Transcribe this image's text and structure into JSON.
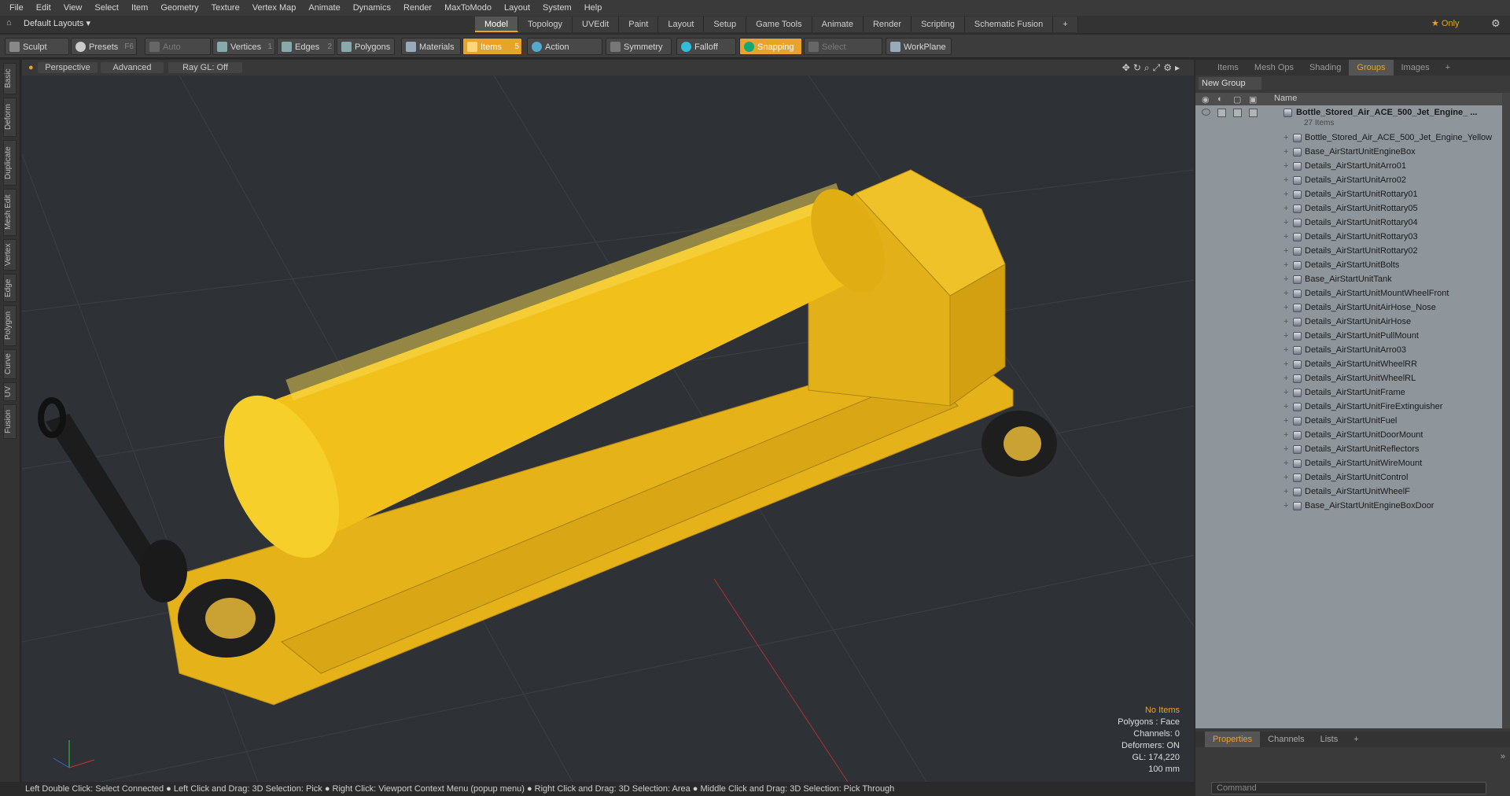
{
  "menu": [
    "File",
    "Edit",
    "View",
    "Select",
    "Item",
    "Geometry",
    "Texture",
    "Vertex Map",
    "Animate",
    "Dynamics",
    "Render",
    "MaxToModo",
    "Layout",
    "System",
    "Help"
  ],
  "layout_dropdown": "Default Layouts ▾",
  "layout_tabs": [
    "Model",
    "Topology",
    "UVEdit",
    "Paint",
    "Layout",
    "Setup",
    "Game Tools",
    "Animate",
    "Render",
    "Scripting",
    "Schematic Fusion",
    "+"
  ],
  "active_layout_tab": "Model",
  "only_label": "★ Only",
  "toolbar": {
    "sculpt": "Sculpt",
    "presets": "Presets",
    "presets_key": "F6",
    "auto_select": "Auto Select",
    "vertices": "Vertices",
    "vertices_key": "1",
    "edges": "Edges",
    "edges_key": "2",
    "polygons": "Polygons",
    "materials": "Materials",
    "items": "Items",
    "items_key": "5",
    "action_center": "Action Center",
    "symmetry": "Symmetry",
    "falloff": "Falloff",
    "snapping": "Snapping",
    "select_through": "Select Through",
    "workplane": "WorkPlane"
  },
  "left_tabs": [
    "Basic",
    "Deform",
    "Duplicate",
    "Mesh Edit",
    "Vertex",
    "Edge",
    "Polygon",
    "Curve",
    "UV",
    "Fusion"
  ],
  "viewport": {
    "perspective": "Perspective",
    "advanced": "Advanced",
    "raygl": "Ray GL: Off",
    "info": {
      "no_items": "No Items",
      "polygons": "Polygons : Face",
      "channels": "Channels: 0",
      "deformers": "Deformers: ON",
      "gl": "GL: 174,220",
      "scale": "100 mm"
    }
  },
  "status": "Left Double Click: Select Connected ● Left Click and Drag: 3D Selection: Pick ● Right Click: Viewport Context Menu (popup menu) ● Right Click and Drag: 3D Selection: Area ● Middle Click and Drag: 3D Selection: Pick Through",
  "right_tabs": [
    "Items",
    "Mesh Ops",
    "Shading",
    "Groups",
    "Images",
    "+"
  ],
  "active_right_tab": "Groups",
  "new_group": "New Group",
  "list_header_name": "Name",
  "group_root": "Bottle_Stored_Air_ACE_500_Jet_Engine_ ...",
  "group_count": "27 Items",
  "group_items": [
    "Bottle_Stored_Air_ACE_500_Jet_Engine_Yellow",
    "Base_AirStartUnitEngineBox",
    "Details_AirStartUnitArro01",
    "Details_AirStartUnitArro02",
    "Details_AirStartUnitRottary01",
    "Details_AirStartUnitRottary05",
    "Details_AirStartUnitRottary04",
    "Details_AirStartUnitRottary03",
    "Details_AirStartUnitRottary02",
    "Details_AirStartUnitBolts",
    "Base_AirStartUnitTank",
    "Details_AirStartUnitMountWheelFront",
    "Details_AirStartUnitAirHose_Nose",
    "Details_AirStartUnitAirHose",
    "Details_AirStartUnitPullMount",
    "Details_AirStartUnitArro03",
    "Details_AirStartUnitWheelRR",
    "Details_AirStartUnitWheelRL",
    "Details_AirStartUnitFrame",
    "Details_AirStartUnitFireExtinguisher",
    "Details_AirStartUnitFuel",
    "Details_AirStartUnitDoorMount",
    "Details_AirStartUnitReflectors",
    "Details_AirStartUnitWireMount",
    "Details_AirStartUnitControl",
    "Details_AirStartUnitWheelF",
    "Base_AirStartUnitEngineBoxDoor"
  ],
  "bottom_tabs": [
    "Properties",
    "Channels",
    "Lists",
    "+"
  ],
  "active_bottom_tab": "Properties",
  "command_placeholder": "Command",
  "colors": {
    "accent": "#e8a32a",
    "model_yellow": "#f2c01a",
    "viewport_bg": "#2e3236"
  }
}
